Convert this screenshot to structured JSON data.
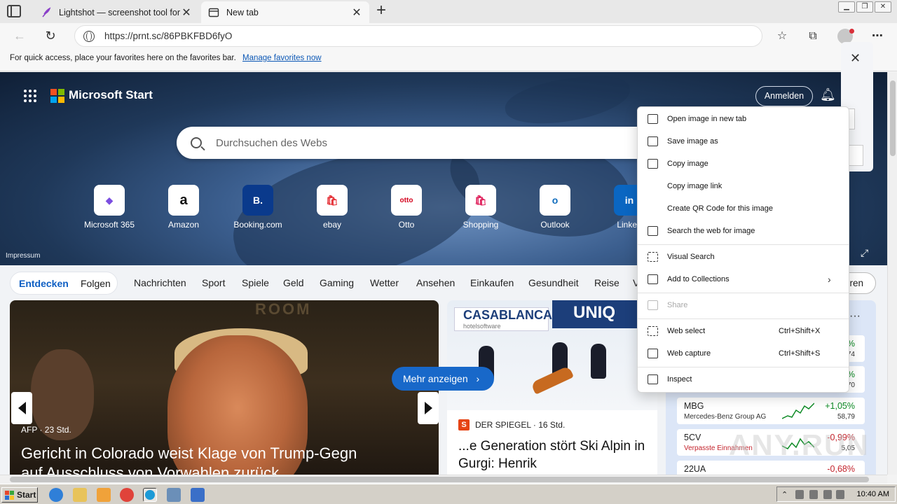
{
  "browser": {
    "tabs": [
      {
        "title": "Lightshot — screenshot tool for M",
        "active": false
      },
      {
        "title": "New tab",
        "active": true
      }
    ],
    "url": "https://prnt.sc/86PBKFBD6fyO",
    "favorites_bar": {
      "message": "For quick access, place your favorites here on the favorites bar.",
      "link": "Manage favorites now"
    }
  },
  "start_page": {
    "brand": "Microsoft Start",
    "signin": "Anmelden",
    "search_placeholder": "Durchsuchen des Webs",
    "quick_links": [
      "Microsoft 365",
      "Amazon",
      "Booking.com",
      "ebay",
      "Otto",
      "Shopping",
      "Outlook",
      "Linked"
    ],
    "quick_link_glyphs": [
      "◆",
      "a",
      "B.",
      "🛍",
      "otto",
      "🛍",
      "o",
      "in"
    ],
    "impressum": "Impressum",
    "categories": {
      "pill": [
        "Entdecken",
        "Folgen"
      ],
      "items": [
        "Nachrichten",
        "Sport",
        "Spiele",
        "Geld",
        "Gaming",
        "Wetter",
        "Ansehen",
        "Einkaufen",
        "Gesundheit",
        "Reise",
        "V"
      ],
      "more_fragment": "eren"
    },
    "main_story": {
      "source": "AFP · 23 Std.",
      "headline_line1": "Gericht in Colorado weist Klage von Trump-Gegn",
      "headline_line2": "auf Ausschluss von Vorwahlen zurück",
      "room_text": "ROOM"
    },
    "more_button": "Mehr anzeigen",
    "second_story": {
      "banner": "CASABLANCA",
      "banner_sub": "hotelsoftware",
      "banner2": "UNIQ",
      "source": "DER SPIEGEL · 16 Std.",
      "source_logo": "S",
      "headline": "...e Generation stört Ski Alpin in Gurgi: Henrik"
    },
    "stocks": {
      "header_dots": "···",
      "rows": [
        {
          "symbol": "",
          "name": "",
          "change": "%",
          "price": "74",
          "direction": "up"
        },
        {
          "symbol": "",
          "name": "",
          "change": "%",
          "price": "70",
          "direction": "up"
        },
        {
          "symbol": "MBG",
          "name": "Mercedes-Benz Group AG",
          "change": "+1,05%",
          "price": "58,79",
          "direction": "up"
        },
        {
          "symbol": "5CV",
          "name": "Verpasste Einnahmen",
          "change": "-0,99%",
          "price": "5,05",
          "direction": "down"
        },
        {
          "symbol": "22UA",
          "name": "",
          "change": "-0,68%",
          "price": "",
          "direction": "down"
        }
      ]
    }
  },
  "context_menu": {
    "items": [
      {
        "label": "Open image in new tab",
        "shortcut": "",
        "disabled": false,
        "icon": "open-tab-icon"
      },
      {
        "label": "Save image as",
        "shortcut": "",
        "disabled": false,
        "icon": "save-image-icon"
      },
      {
        "label": "Copy image",
        "shortcut": "",
        "disabled": false,
        "icon": "copy-image-icon"
      },
      {
        "label": "Copy image link",
        "shortcut": "",
        "disabled": false,
        "icon": ""
      },
      {
        "label": "Create QR Code for this image",
        "shortcut": "",
        "disabled": false,
        "icon": ""
      },
      {
        "label": "Search the web for image",
        "shortcut": "",
        "disabled": false,
        "icon": "search-image-icon"
      },
      {
        "label": "Visual Search",
        "shortcut": "",
        "disabled": false,
        "icon": "visual-search-icon"
      },
      {
        "label": "Add to Collections",
        "shortcut": "",
        "disabled": false,
        "icon": "collections-icon",
        "submenu": true
      },
      {
        "label": "Share",
        "shortcut": "",
        "disabled": true,
        "icon": "share-icon"
      },
      {
        "label": "Web select",
        "shortcut": "Ctrl+Shift+X",
        "disabled": false,
        "icon": "web-select-icon"
      },
      {
        "label": "Web capture",
        "shortcut": "Ctrl+Shift+S",
        "disabled": false,
        "icon": "web-capture-icon"
      },
      {
        "label": "Inspect",
        "shortcut": "",
        "disabled": false,
        "icon": "inspect-icon"
      }
    ]
  },
  "taskbar": {
    "start": "Start",
    "clock": "10:40 AM"
  },
  "watermark": "ANY.RUN",
  "colors": {
    "accent_blue": "#1868c9",
    "stock_up": "#0c8a24",
    "stock_down": "#c3232c"
  }
}
